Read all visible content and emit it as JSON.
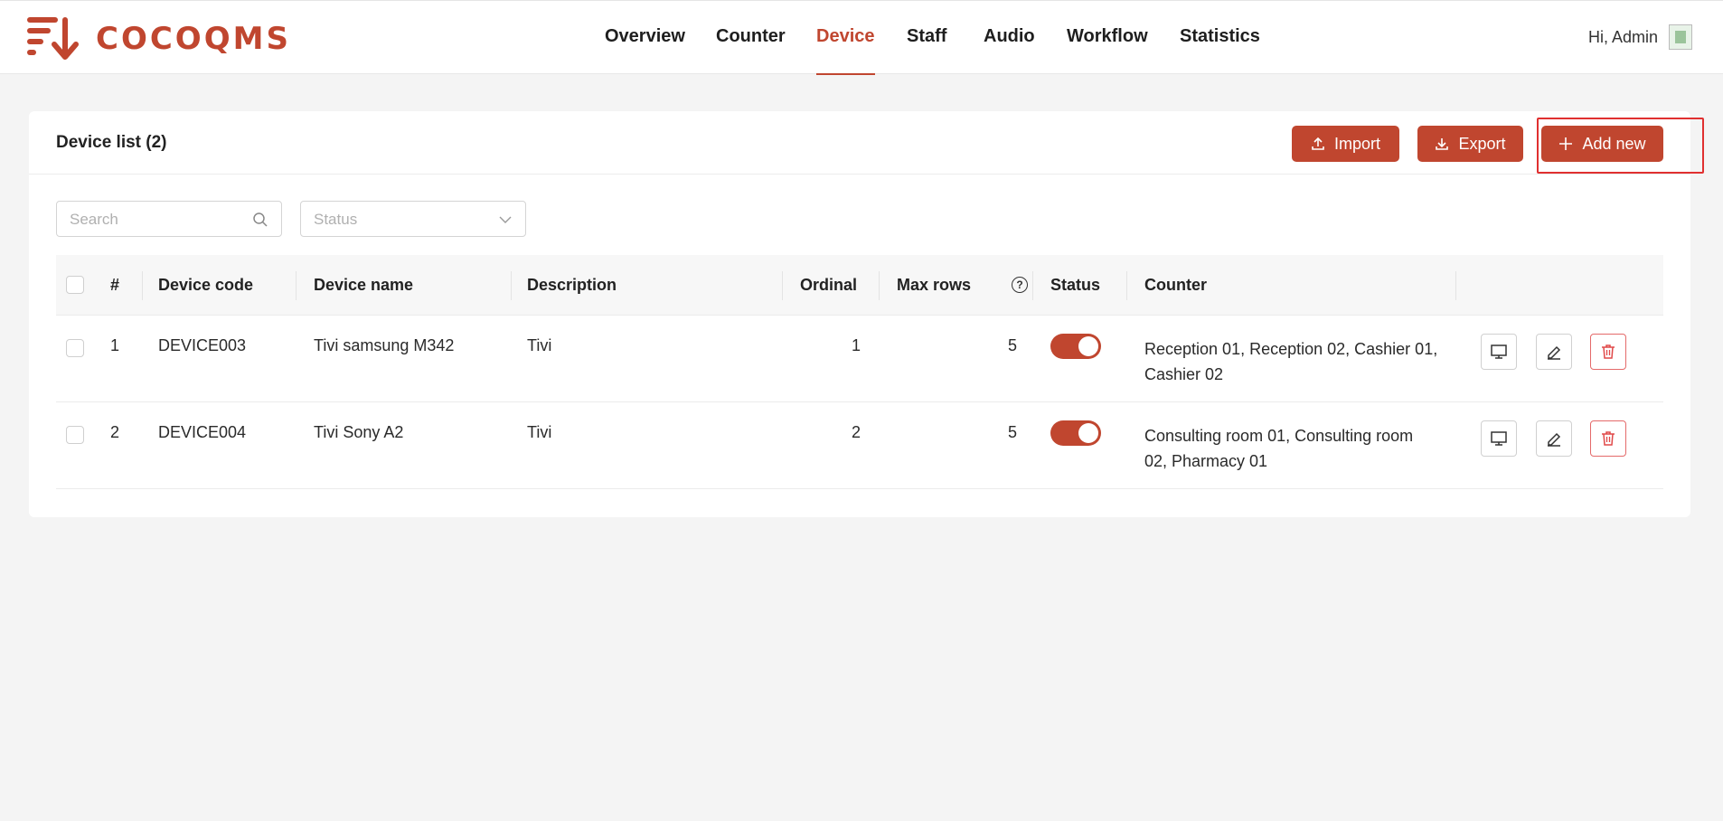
{
  "header": {
    "brand": "COCOQMS",
    "nav": [
      "Overview",
      "Counter",
      "Device",
      "Staff",
      "Audio",
      "Workflow",
      "Statistics"
    ],
    "active_nav": "Device",
    "greeting": "Hi, Admin"
  },
  "card": {
    "title": "Device list (2)",
    "buttons": {
      "import": "Import",
      "export": "Export",
      "add": "Add new"
    }
  },
  "filters": {
    "search_placeholder": "Search",
    "status_placeholder": "Status"
  },
  "table": {
    "columns": [
      "#",
      "Device code",
      "Device name",
      "Description",
      "Ordinal",
      "Max rows",
      "Status",
      "Counter"
    ],
    "rows": [
      {
        "index": "1",
        "code": "DEVICE003",
        "name": "Tivi samsung M342",
        "description": "Tivi",
        "ordinal": "1",
        "max_rows": "5",
        "status": "on",
        "counter": "Reception 01, Reception 02, Cashier 01, Cashier 02"
      },
      {
        "index": "2",
        "code": "DEVICE004",
        "name": "Tivi Sony A2",
        "description": "Tivi",
        "ordinal": "2",
        "max_rows": "5",
        "status": "on",
        "counter": "Consulting room 01, Consulting room 02, Pharmacy 01"
      }
    ]
  },
  "colors": {
    "accent": "#c0462f",
    "highlight": "#e03030"
  },
  "icons": [
    "logo-icon",
    "upload-icon",
    "download-icon",
    "plus-icon",
    "search-icon",
    "chevron-down-icon",
    "help-icon",
    "monitor-icon",
    "edit-icon",
    "trash-icon"
  ]
}
